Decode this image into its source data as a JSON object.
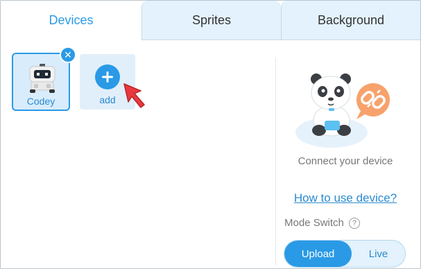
{
  "tabs": [
    {
      "label": "Devices",
      "active": true
    },
    {
      "label": "Sprites",
      "active": false
    },
    {
      "label": "Background",
      "active": false
    }
  ],
  "devices": [
    {
      "name": "Codey",
      "selected": true
    }
  ],
  "add_card": {
    "label": "add"
  },
  "right_panel": {
    "connect_text": "Connect your device",
    "help_link": "How to use device?",
    "mode_switch_label": "Mode Switch",
    "modes": [
      "Upload",
      "Live"
    ],
    "active_mode": "Upload"
  },
  "icons": {
    "close": "close-icon",
    "add": "plus-icon",
    "help": "question-icon",
    "cursor": "red-arrow-cursor",
    "mascot": "panda-disconnected-illustration"
  },
  "colors": {
    "accent": "#2a9ae6",
    "tab_inactive": "#e3f2fc",
    "cursor": "#e8393f",
    "mascot_badge": "#f7a26c"
  }
}
